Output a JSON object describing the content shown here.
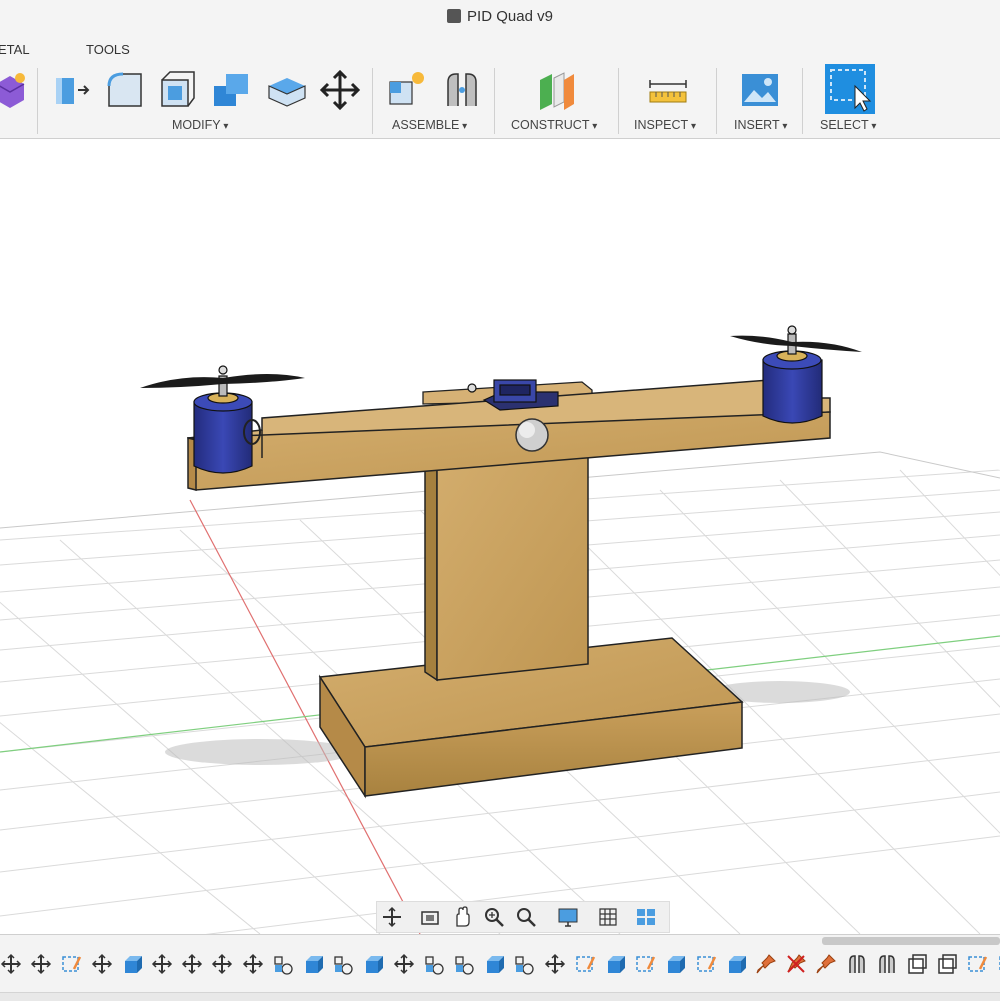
{
  "window": {
    "title": "PID Quad v9"
  },
  "toolbar": {
    "tabs": [
      "ETAL",
      "TOOLS"
    ],
    "groups": {
      "modify": "MODIFY",
      "assemble": "ASSEMBLE",
      "construct": "CONSTRUCT",
      "inspect": "INSPECT",
      "insert": "INSERT",
      "select": "SELECT"
    },
    "icons": {
      "create": "create-solid-icon",
      "modify": [
        "press-pull-icon",
        "fillet-icon",
        "shell-icon",
        "combine-icon",
        "replace-face-icon",
        "move-icon"
      ],
      "assemble": [
        "new-component-icon",
        "joint-icon"
      ],
      "construct": "offset-plane-icon",
      "inspect": "measure-icon",
      "insert": "insert-image-icon",
      "select": "select-icon"
    },
    "colors": {
      "accent": "#3a8fd6",
      "select_bg": "#1f8ee0"
    }
  },
  "viewport": {
    "model": "PID Quad test rig",
    "colors": {
      "wood": "#c9a263",
      "wood_dark": "#a9843f",
      "motor": "#2f3a9a",
      "grid": "#d6d6d6",
      "x_axis": "#e06060",
      "y_axis": "#60c060"
    }
  },
  "navbar": {
    "icons": [
      "orbit-icon",
      "look-at-icon",
      "pan-icon",
      "zoom-icon",
      "fit-icon",
      "display-settings-icon",
      "grid-settings-icon",
      "viewports-icon"
    ]
  },
  "timeline": {
    "icons": [
      "move-icon",
      "move-icon",
      "sketch-icon",
      "move-icon",
      "extrude-icon",
      "move-icon",
      "move-icon",
      "move-icon",
      "move-icon",
      "joint-icon",
      "extrude-icon",
      "joint-icon",
      "extrude-icon",
      "move-icon",
      "joint-icon",
      "joint-icon",
      "extrude-icon",
      "joint-icon",
      "move-icon",
      "sketch-icon",
      "extrude-icon",
      "sketch-icon",
      "extrude-icon",
      "sketch-icon",
      "extrude-icon",
      "pin-icon",
      "pin-broken-icon",
      "pin-icon",
      "motion-icon",
      "motion-icon",
      "shell-icon",
      "shell-icon",
      "sketch-icon",
      "sketch-icon"
    ]
  }
}
